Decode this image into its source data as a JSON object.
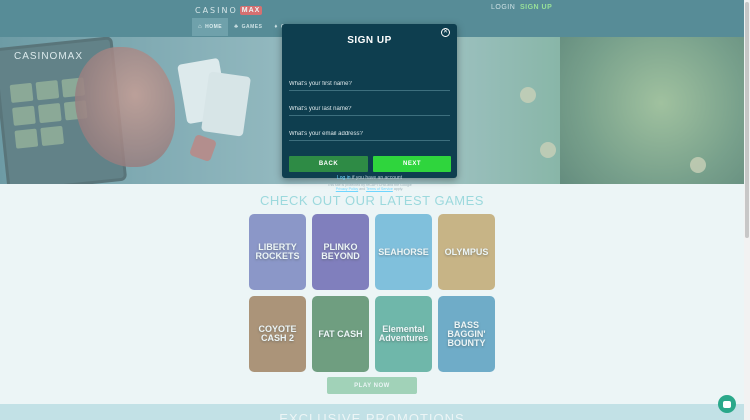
{
  "header": {
    "logo_text": "CASINO",
    "logo_badge": "MAX",
    "login": "LOGIN",
    "signup": "SIGN UP",
    "nav": [
      {
        "label": "HOME",
        "icon": "home-icon"
      },
      {
        "label": "GAMES",
        "icon": "games-icon"
      },
      {
        "label": "C",
        "icon": "promotions-icon"
      }
    ]
  },
  "hero": {
    "tablet_title": "CASINOMAX"
  },
  "games_section": {
    "title": "CHECK OUT OUR LATEST GAMES",
    "games": [
      {
        "name": "LIBERTY ROCKETS",
        "color": "#6a6fb8"
      },
      {
        "name": "PLINKO BEYOND",
        "color": "#5a4aa8"
      },
      {
        "name": "SEAHORSE",
        "color": "#5aaed8"
      },
      {
        "name": "OLYMPUS",
        "color": "#c79b54"
      },
      {
        "name": "COYOTE CASH 2",
        "color": "#9b6a3f"
      },
      {
        "name": "FAT CASH",
        "color": "#3f7a4a"
      },
      {
        "name": "Elemental Adventures",
        "color": "#3fa08a"
      },
      {
        "name": "BASS BAGGIN' BOUNTY",
        "color": "#3f8fb8"
      }
    ],
    "cta": "PLAY NOW"
  },
  "promo": {
    "title": "EXCLUSIVE PROMOTIONS"
  },
  "modal": {
    "title": "SIGN UP",
    "first_name_placeholder": "What's your first name?",
    "last_name_placeholder": "What's your last name?",
    "email_placeholder": "What's your email address?",
    "back": "BACK",
    "next": "NEXT",
    "login_link": "Log in",
    "login_suffix": " if you have an account",
    "recaptcha_line1": "This site is protected by reCAPTCHA and the Google",
    "privacy_link": "Privacy Policy",
    "and_text": " and ",
    "terms_link": "Terms of Service",
    "apply_text": " apply."
  },
  "colors": {
    "modal_bg": "#0e3e4f",
    "next_button": "#2fd53d",
    "back_button": "#2e8b45",
    "section_title": "#84d4d9"
  }
}
